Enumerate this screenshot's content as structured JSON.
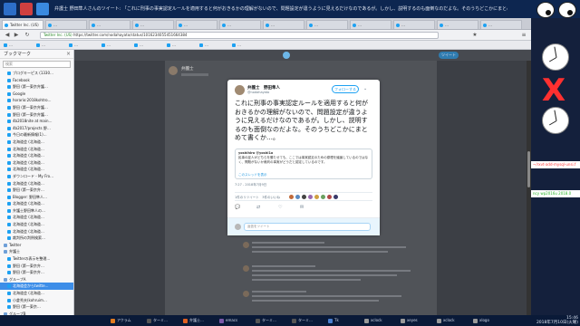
{
  "window": {
    "title": "弁護士 野田隼人さんのツイート: 「これに刑事の事実認定ルールを適用すると何がおきるかの理解がないので、問題設定が違うように見えるだけなのであるが。しかし、説明するのも面倒なのだよな。そのうちどこかにまとめて書くか…」 - Mozilla Firefox"
  },
  "tabs": [
    "Twitter Inc. (US)",
    "…",
    "…",
    "…",
    "…",
    "…",
    "…",
    "…",
    "…",
    "…",
    "…",
    "…"
  ],
  "navbar": {
    "url_site": "Twitter Inc. (US)",
    "url_path": "https://twitter.com/nodahayato/status/1016234055451664384"
  },
  "bookmarks_toolbar": [
    "…",
    "…",
    "…",
    "…",
    "…",
    "…",
    "…",
    "…"
  ],
  "sidebar": {
    "title": "ブックマーク",
    "search_placeholder": "検索",
    "items": [
      {
        "label": "ブログキーピス (1330…",
        "type": "item"
      },
      {
        "label": "Facebook",
        "type": "item"
      },
      {
        "label": "野田 (第一東京弁護…",
        "type": "item"
      },
      {
        "label": "Google",
        "type": "item"
      },
      {
        "label": "horario:2018kohtro…",
        "type": "item"
      },
      {
        "label": "野田 (第一東京弁護…",
        "type": "item"
      },
      {
        "label": "野田 (第一東京弁護…",
        "type": "item"
      },
      {
        "label": "4b2018nite at main…",
        "type": "item"
      },
      {
        "label": "4b2017/projects 野…",
        "type": "item"
      },
      {
        "label": "今日の最新情報(1)…",
        "type": "item"
      },
      {
        "label": "北海道会 (北海道…",
        "type": "item"
      },
      {
        "label": "北海道会 (北海道…",
        "type": "item"
      },
      {
        "label": "北海道会 (北海道…",
        "type": "item"
      },
      {
        "label": "北海道会 (北海道…",
        "type": "item"
      },
      {
        "label": "北海道会 (北海道…",
        "type": "item"
      },
      {
        "label": "ダウンロード - My Fro…",
        "type": "item"
      },
      {
        "label": "北海道会 (北海道…",
        "type": "item"
      },
      {
        "label": "野田 (第一東京弁…",
        "type": "item"
      },
      {
        "label": "Blogger: 野田隼人…",
        "type": "item"
      },
      {
        "label": "北海道会 (北海道…",
        "type": "item"
      },
      {
        "label": "弁護士野田隼人の…",
        "type": "item"
      },
      {
        "label": "北海道会 (北海道…",
        "type": "item"
      },
      {
        "label": "北海道会 (北海道…",
        "type": "item"
      },
      {
        "label": "北海道会 (北海道…",
        "type": "item"
      },
      {
        "label": "裁判所の判例検索…",
        "type": "item"
      },
      {
        "label": "Twitter",
        "type": "folder"
      },
      {
        "label": "弁護士",
        "type": "folder"
      },
      {
        "label": "Twitterの表示を整理…",
        "type": "item"
      },
      {
        "label": "野田 (第一東京弁…",
        "type": "item"
      },
      {
        "label": "野田 (第一東京弁…",
        "type": "item"
      },
      {
        "label": "グループA",
        "type": "folder"
      },
      {
        "label": "北海道会からtwitte…",
        "type": "item",
        "selected": true
      },
      {
        "label": "北海道会 (北海道…",
        "type": "item"
      },
      {
        "label": "小倉秀夫(kohruim…",
        "type": "item"
      },
      {
        "label": "野田 (第一東京…",
        "type": "item"
      },
      {
        "label": "グループB",
        "type": "folder"
      },
      {
        "label": "松本正幸(Policy…",
        "type": "item"
      },
      {
        "label": "高田千早(@Yuji Or…",
        "type": "item"
      }
    ]
  },
  "profile": {
    "name": "弁護士",
    "tweet_button": "ツイート"
  },
  "tweet": {
    "author_name": "弁護士　野田隼人",
    "author_handle": "@nodahayato",
    "follow_label": "フォローする",
    "text": "これに刑事の事実認定ルールを適用すると何がおきるかの理解がないので、問題設定が違うように見えるだけなのであるが。しかし、説明するのも面倒なのだよな。そのうちどこかにまとめて書くか…。",
    "quote": {
      "author": "yoshihiro @yoshi1o",
      "text": "民事の証人がどちらを勝たせても、ここでは事実認定のための原理を議論しているのではなく、問題がないか裁判の事実がどうだと認定しているのです。",
      "link": "このスレッドを表示"
    },
    "timestamp": "7:27 - 2018年7月9日",
    "stats": "1件のリツイート　3件のいいね",
    "reply_placeholder": "返信をツイート"
  },
  "desktop": {
    "windows": [
      {
        "label": "~/rxvt-add-mysql-unsi.f",
        "color": "#ff4040"
      },
      {
        "label": "ncy wp2016u 2018.0",
        "color": "#2db52d"
      }
    ]
  },
  "taskbar": {
    "items": [
      {
        "label": "アクラム",
        "color": "#e07b20"
      },
      {
        "label": "ターミ…",
        "color": "#555555"
      },
      {
        "label": "弁護士…",
        "color": "#e06020"
      },
      {
        "label": "emacs",
        "color": "#7a58a8"
      },
      {
        "label": "ターミ…",
        "color": "#555555"
      },
      {
        "label": "ターミ…",
        "color": "#555555"
      },
      {
        "label": "Tk",
        "color": "#4a7fd0"
      },
      {
        "label": "xclock",
        "color": "#999999"
      },
      {
        "label": "xeyes",
        "color": "#999999"
      },
      {
        "label": "xclock",
        "color": "#999999"
      },
      {
        "label": "xlogo",
        "color": "#999999"
      }
    ],
    "time": "15:46",
    "date": "2018年7月10日(火曜)"
  }
}
